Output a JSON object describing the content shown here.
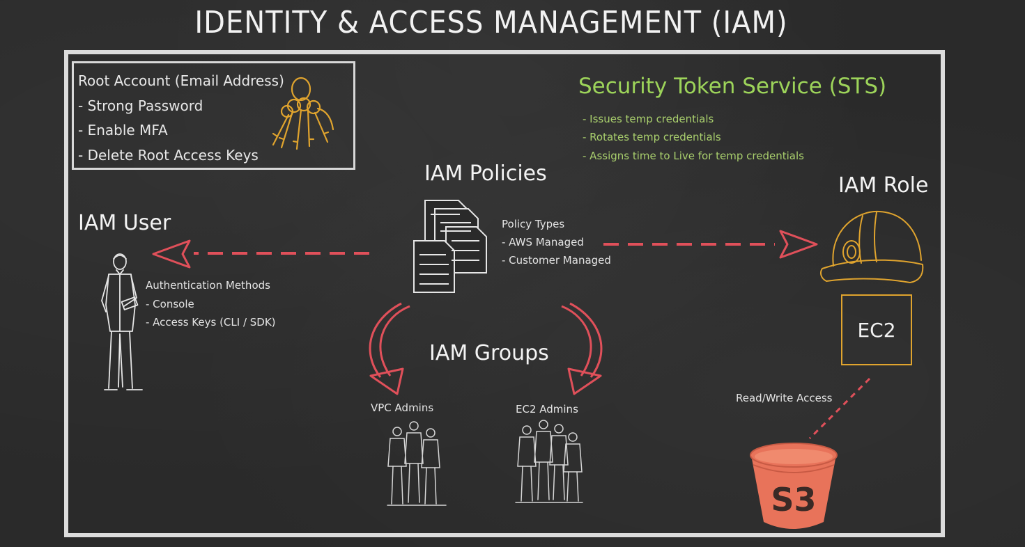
{
  "title": "IDENTITY & ACCESS MANAGEMENT (IAM)",
  "root_account": {
    "heading": "Root Account (Email Address)",
    "items": [
      "- Strong Password",
      "- Enable MFA",
      "- Delete Root Access Keys"
    ]
  },
  "sts": {
    "title": "Security Token Service (STS)",
    "items": [
      "- Issues temp credentials",
      "- Rotates temp credentials",
      "- Assigns time to Live for temp credentials"
    ]
  },
  "iam_policies": {
    "title": "IAM Policies",
    "types_label": "Policy Types",
    "types": [
      "- AWS Managed",
      "- Customer Managed"
    ]
  },
  "iam_user": {
    "title": "IAM User",
    "auth_label": "Authentication Methods",
    "methods": [
      "- Console",
      "- Access Keys (CLI / SDK)"
    ]
  },
  "iam_role": {
    "title": "IAM Role"
  },
  "ec2": {
    "label": "EC2"
  },
  "iam_groups": {
    "title": "IAM Groups",
    "groups": [
      "VPC Admins",
      "EC2 Admins"
    ]
  },
  "s3": {
    "access_label": "Read/Write Access",
    "label": "S3"
  },
  "colors": {
    "arrow_red": "#e0505a",
    "sts_green": "#9dd45a",
    "gold": "#e0a42e",
    "s3_orange": "#e8735a"
  }
}
